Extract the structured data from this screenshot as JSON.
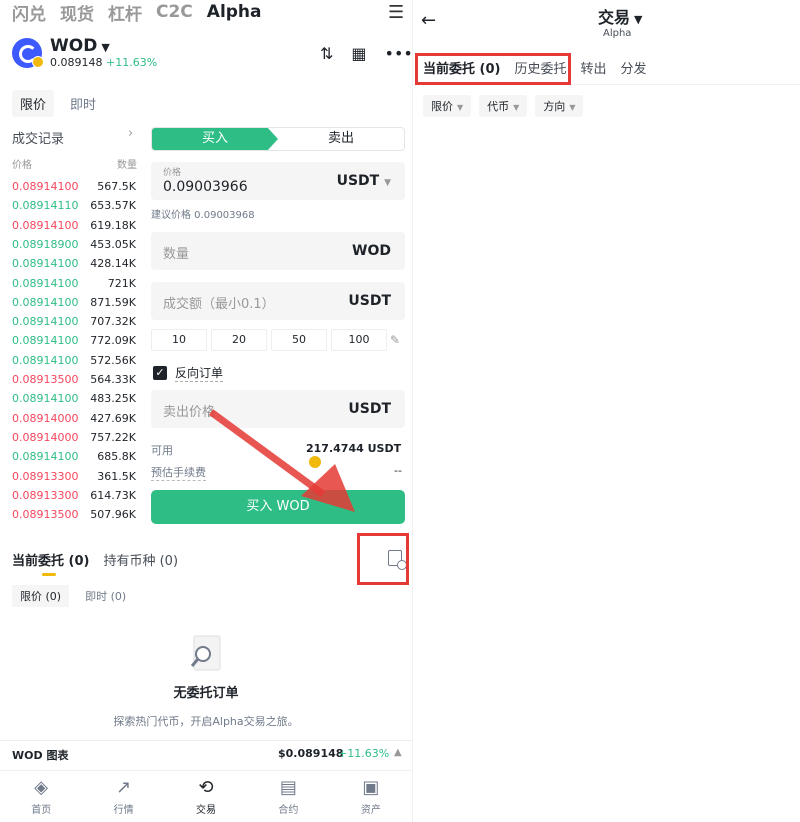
{
  "nav": {
    "tabs": [
      "闪兑",
      "现货",
      "杠杆",
      "C2C",
      "Alpha"
    ],
    "active": "Alpha",
    "menu_icon": "hamburger-icon"
  },
  "coin": {
    "symbol": "WOD",
    "price": "0.089148",
    "change": "+11.63%"
  },
  "order_types": {
    "limit": "限价",
    "market": "即时"
  },
  "trades": {
    "title": "成交记录",
    "price_header": "价格",
    "qty_header": "数量",
    "rows": [
      {
        "price": "0.08914100",
        "qty": "567.5K",
        "side": "sell"
      },
      {
        "price": "0.08914110",
        "qty": "653.57K",
        "side": "buy"
      },
      {
        "price": "0.08914100",
        "qty": "619.18K",
        "side": "sell"
      },
      {
        "price": "0.08918900",
        "qty": "453.05K",
        "side": "buy"
      },
      {
        "price": "0.08914100",
        "qty": "428.14K",
        "side": "buy"
      },
      {
        "price": "0.08914100",
        "qty": "721K",
        "side": "buy"
      },
      {
        "price": "0.08914100",
        "qty": "871.59K",
        "side": "buy"
      },
      {
        "price": "0.08914100",
        "qty": "707.32K",
        "side": "buy"
      },
      {
        "price": "0.08914100",
        "qty": "772.09K",
        "side": "buy"
      },
      {
        "price": "0.08914100",
        "qty": "572.56K",
        "side": "buy"
      },
      {
        "price": "0.08913500",
        "qty": "564.33K",
        "side": "sell"
      },
      {
        "price": "0.08914100",
        "qty": "483.25K",
        "side": "buy"
      },
      {
        "price": "0.08914000",
        "qty": "427.69K",
        "side": "sell"
      },
      {
        "price": "0.08914000",
        "qty": "757.22K",
        "side": "sell"
      },
      {
        "price": "0.08914100",
        "qty": "685.8K",
        "side": "buy"
      },
      {
        "price": "0.08913300",
        "qty": "361.5K",
        "side": "sell"
      },
      {
        "price": "0.08913300",
        "qty": "614.73K",
        "side": "sell"
      },
      {
        "price": "0.08913500",
        "qty": "507.96K",
        "side": "sell"
      }
    ]
  },
  "form": {
    "buy_tab": "买入",
    "sell_tab": "卖出",
    "price_label": "价格",
    "price_value": "0.09003966",
    "price_unit": "USDT",
    "suggested": "建议价格 0.09003968",
    "qty_placeholder": "数量",
    "qty_unit": "WOD",
    "amount_placeholder": "成交额（最小0.1）",
    "amount_unit": "USDT",
    "presets": [
      "10",
      "20",
      "50",
      "100"
    ],
    "reverse_label": "反向订单",
    "sell_price_placeholder": "卖出价格",
    "sell_price_unit": "USDT",
    "available_label": "可用",
    "available_value": "217.4744 USDT",
    "fee_label": "预估手续费",
    "fee_value": "--",
    "buy_button": "买入 WOD"
  },
  "orders": {
    "tab_current": "当前委托 (0)",
    "tab_holdings": "持有币种 (0)",
    "sub_limit": "限价 (0)",
    "sub_market": "即时 (0)",
    "empty_title": "无委托订单",
    "empty_desc": "探索热门代币，开启Alpha交易之旅。"
  },
  "chart_bar": {
    "label": "WOD 图表",
    "price": "$0.089148",
    "change": "+11.63%"
  },
  "bottom_nav": [
    {
      "label": "首页",
      "icon": "home-icon"
    },
    {
      "label": "行情",
      "icon": "markets-icon"
    },
    {
      "label": "交易",
      "icon": "trade-icon"
    },
    {
      "label": "合约",
      "icon": "futures-icon"
    },
    {
      "label": "资产",
      "icon": "wallet-icon"
    }
  ],
  "right": {
    "title": "交易",
    "subtitle": "Alpha",
    "tabs": [
      "当前委托 (0)",
      "历史委托",
      "转出",
      "分发"
    ],
    "filters": [
      "限价",
      "代币",
      "方向"
    ]
  },
  "colors": {
    "green": "#2ebd85",
    "red": "#f6465d",
    "highlight": "#e53935"
  }
}
